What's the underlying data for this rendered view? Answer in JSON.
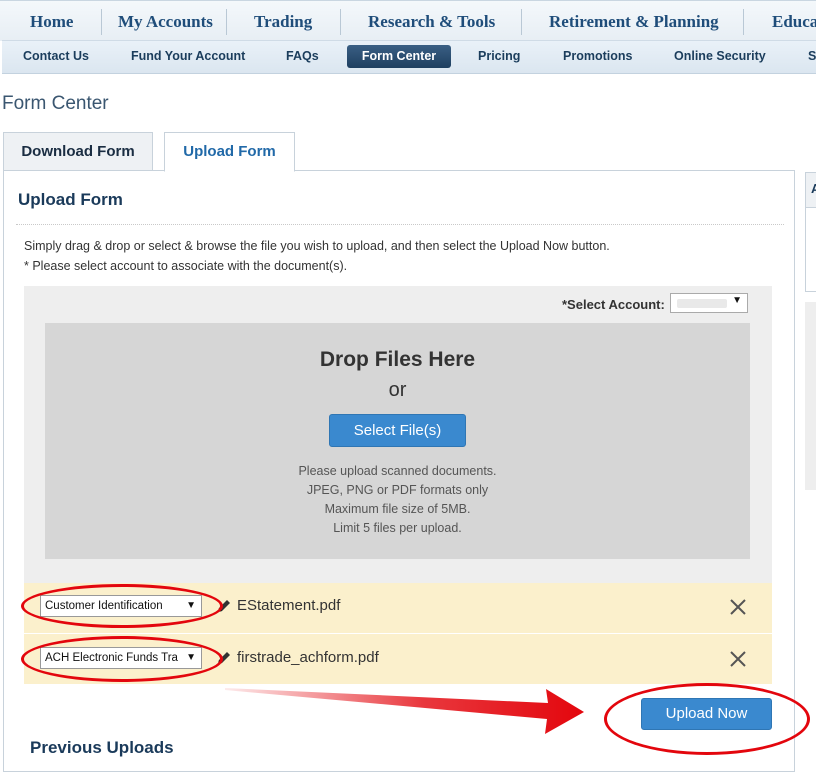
{
  "nav": {
    "main": [
      "Home",
      "My Accounts",
      "Trading",
      "Research & Tools",
      "Retirement & Planning",
      "Educa"
    ],
    "sub": [
      "Contact Us",
      "Fund Your Account",
      "FAQs",
      "Form Center",
      "Pricing",
      "Promotions",
      "Online Security",
      "Si"
    ],
    "active_sub": "Form Center"
  },
  "page": {
    "title": "Form Center"
  },
  "tabs": {
    "download": "Download Form",
    "upload": "Upload Form",
    "active": "Upload Form"
  },
  "upload": {
    "heading": "Upload Form",
    "instruction1": "Simply drag & drop or select & browse the file you wish to upload, and then select the Upload Now button.",
    "instruction2": "* Please select account to associate with the document(s).",
    "account_label": "*Select Account:",
    "account_value": "",
    "drop_title": "Drop Files Here",
    "drop_or": "or",
    "select_button": "Select File(s)",
    "notes": [
      "Please upload scanned documents.",
      "JPEG, PNG or PDF formats only",
      "Maximum file size of 5MB.",
      "Limit 5 files per upload."
    ],
    "files": [
      {
        "doc_type": "Customer Identification",
        "name": "EStatement.pdf"
      },
      {
        "doc_type": "ACH Electronic Funds Tra",
        "name": "firstrade_achform.pdf"
      }
    ],
    "upload_button": "Upload Now",
    "previous_heading": "Previous Uploads"
  },
  "side_panel": {
    "label": "A"
  },
  "colors": {
    "brand_blue": "#1f4d7a",
    "button_blue": "#3a89cf",
    "highlight_red": "#e3060d",
    "file_row_bg": "#fbf0cc",
    "dropzone_gray": "#d6d6d6"
  },
  "icons": [
    "pencil-icon",
    "close-icon",
    "chevron-down-icon"
  ]
}
